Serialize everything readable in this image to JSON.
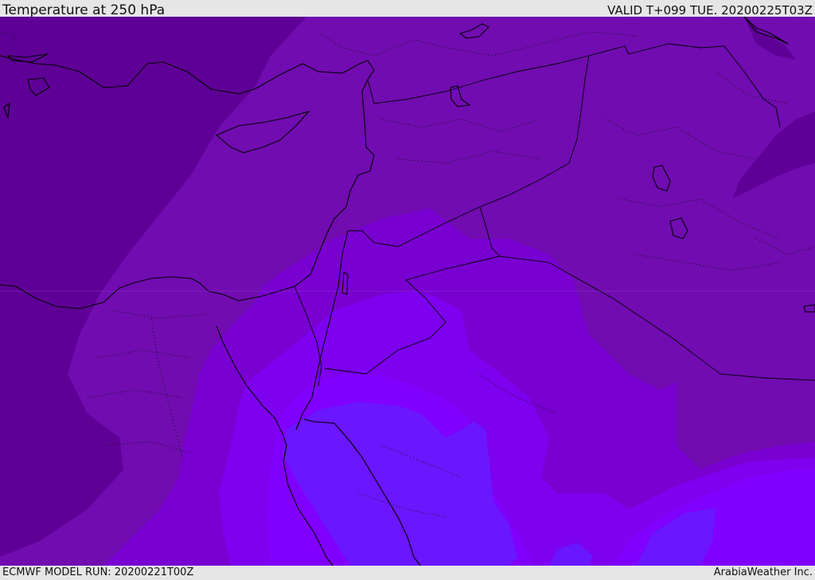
{
  "header": {
    "title": "Temperature at 250 hPa",
    "valid": "VALID T+099 TUE. 20200225T03Z"
  },
  "footer": {
    "run": "ECMWF MODEL RUN: 20200221T00Z",
    "credit": "ArabiaWeather Inc."
  },
  "map": {
    "field": "temperature",
    "level_hpa": 250,
    "color_bands": [
      "#5e0096",
      "#700cb0",
      "#7800d0",
      "#7d00ee",
      "#8000ff",
      "#6a16ff"
    ],
    "coastline_color": "#000000"
  }
}
